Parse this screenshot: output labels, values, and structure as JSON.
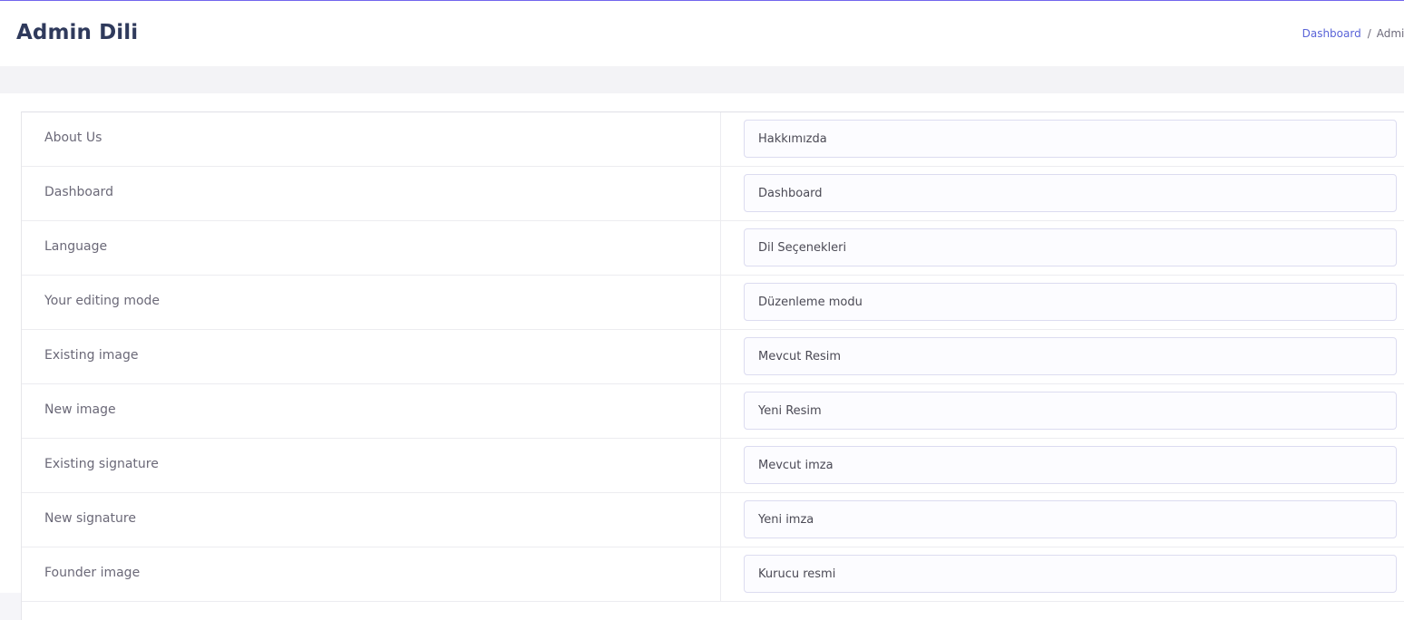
{
  "header": {
    "title": "Admin Dili",
    "breadcrumb": {
      "items": [
        "Dashboard",
        "Admin"
      ],
      "separator": "/"
    }
  },
  "colors": {
    "accent": "#7367f0",
    "link": "#5a64d8",
    "title": "#2f3a5c"
  },
  "rows": [
    {
      "label": "About Us",
      "value": "Hakkımızda"
    },
    {
      "label": "Dashboard",
      "value": "Dashboard"
    },
    {
      "label": "Language",
      "value": "Dil Seçenekleri"
    },
    {
      "label": "Your editing mode",
      "value": "Düzenleme modu"
    },
    {
      "label": "Existing image",
      "value": "Mevcut Resim"
    },
    {
      "label": "New image",
      "value": "Yeni Resim"
    },
    {
      "label": "Existing signature",
      "value": "Mevcut imza"
    },
    {
      "label": "New signature",
      "value": "Yeni imza"
    },
    {
      "label": "Founder image",
      "value": "Kurucu resmi"
    }
  ]
}
